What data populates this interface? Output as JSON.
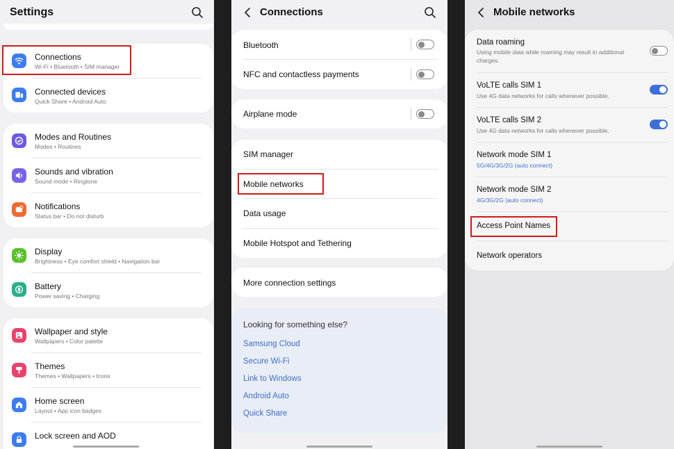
{
  "settings": {
    "title": "Settings",
    "items": [
      {
        "label": "Connections",
        "sub": "Wi-Fi • Bluetooth • SIM manager",
        "icon": "wifi-icon",
        "color": "#3d7cf0"
      },
      {
        "label": "Connected devices",
        "sub": "Quick Share • Android Auto",
        "icon": "devices-icon",
        "color": "#3d7cf0"
      },
      {
        "label": "Modes and Routines",
        "sub": "Modes • Routines",
        "icon": "check-circle-icon",
        "color": "#6b5ae6"
      },
      {
        "label": "Sounds and vibration",
        "sub": "Sound mode • Ringtone",
        "icon": "volume-icon",
        "color": "#7b61e8"
      },
      {
        "label": "Notifications",
        "sub": "Status bar • Do not disturb",
        "icon": "notification-icon",
        "color": "#ef6a33"
      },
      {
        "label": "Display",
        "sub": "Brightness • Eye comfort shield • Navigation bar",
        "icon": "sun-icon",
        "color": "#5ac02c"
      },
      {
        "label": "Battery",
        "sub": "Power saving • Charging",
        "icon": "battery-icon",
        "color": "#2cae8a"
      },
      {
        "label": "Wallpaper and style",
        "sub": "Wallpapers • Color palette",
        "icon": "wallpaper-icon",
        "color": "#e8436b"
      },
      {
        "label": "Themes",
        "sub": "Themes • Wallpapers • Icons",
        "icon": "themes-icon",
        "color": "#e8436b"
      },
      {
        "label": "Home screen",
        "sub": "Layout • App icon badges",
        "icon": "home-icon",
        "color": "#3d7cf0"
      },
      {
        "label": "Lock screen and AOD",
        "sub": "",
        "icon": "lock-icon",
        "color": "#3d7cf0"
      }
    ]
  },
  "connections": {
    "title": "Connections",
    "toggles": [
      {
        "label": "Bluetooth",
        "state": "off"
      },
      {
        "label": "NFC and contactless payments",
        "state": "off"
      },
      {
        "label": "Airplane mode",
        "state": "off"
      }
    ],
    "items": [
      "SIM manager",
      "Mobile networks",
      "Data usage",
      "Mobile Hotspot and Tethering"
    ],
    "more": "More connection settings",
    "looking": {
      "title": "Looking for something else?",
      "links": [
        "Samsung Cloud",
        "Secure Wi-Fi",
        "Link to Windows",
        "Android Auto",
        "Quick Share"
      ]
    }
  },
  "mobile_networks": {
    "title": "Mobile networks",
    "data_roaming": {
      "label": "Data roaming",
      "sub": "Using mobile data while roaming may result in additional charges.",
      "state": "off"
    },
    "volte1": {
      "label": "VoLTE calls SIM 1",
      "sub": "Use 4G data networks for calls whenever possible.",
      "state": "on"
    },
    "volte2": {
      "label": "VoLTE calls SIM 2",
      "sub": "Use 4G data networks for calls whenever possible.",
      "state": "on"
    },
    "mode1": {
      "label": "Network mode SIM 1",
      "value": "5G/4G/3G/2G (auto connect)"
    },
    "mode2": {
      "label": "Network mode SIM 2",
      "value": "4G/3G/2G (auto connect)"
    },
    "apn": "Access Point Names",
    "operators": "Network operators"
  },
  "colors": {
    "highlight": "#d01a1a",
    "accent": "#3e6fd8",
    "link": "#3f6fc7"
  }
}
